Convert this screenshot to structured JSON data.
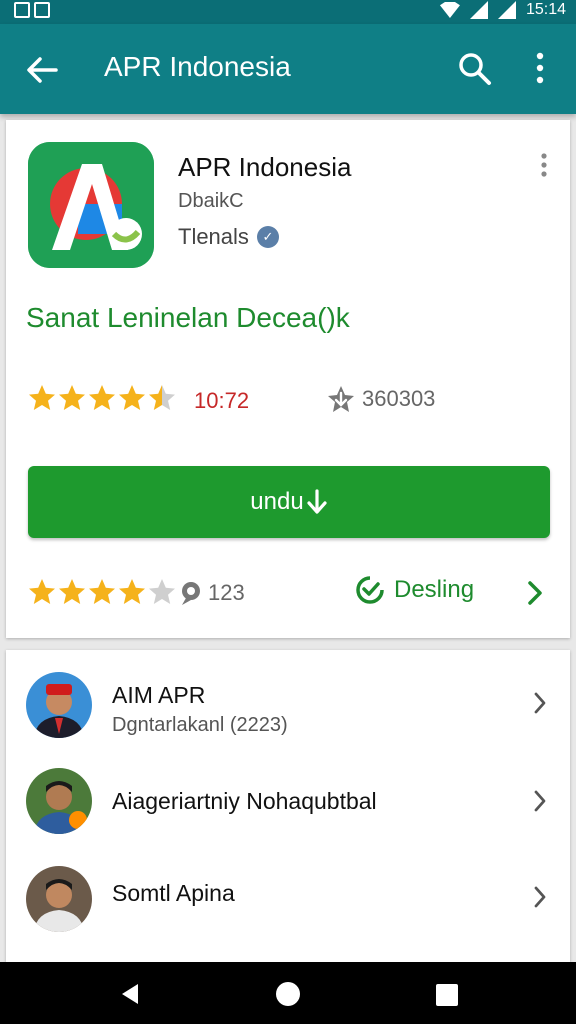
{
  "status_bar": {
    "time": "15:14",
    "icons": [
      "notification-icon",
      "clipboard-icon",
      "wifi-icon",
      "signal-icon",
      "signal-icon"
    ]
  },
  "app_bar": {
    "title": "APR Indonesia",
    "icons": [
      "back-arrow-icon",
      "search-icon",
      "more-vert-icon"
    ]
  },
  "app_card": {
    "name": "APR Indonesia",
    "developer": "DbaikC",
    "category": "Tlenals",
    "verified_symbol": "✓",
    "tagline": "Sanat Leninelan Decea()k",
    "rating": {
      "stars": 4.5,
      "count": "10:72"
    },
    "downloads": "360303",
    "install_button": {
      "label": "undu",
      "icon": "download-arrow-icon"
    },
    "rating2": {
      "stars": 4,
      "count": "123"
    },
    "details_link": "Desling"
  },
  "people": [
    {
      "name": "AIM APR",
      "subtitle": "Dgntarlakanl (2223)"
    },
    {
      "name": "Aiageriartniy Nohaqubtbal",
      "subtitle": ""
    },
    {
      "name": "Somtl Apina",
      "subtitle": ""
    }
  ],
  "colors": {
    "teal": "#0f7f86",
    "green": "#1e9a2e",
    "star": "#f5b21b",
    "count_red": "#c62828"
  }
}
